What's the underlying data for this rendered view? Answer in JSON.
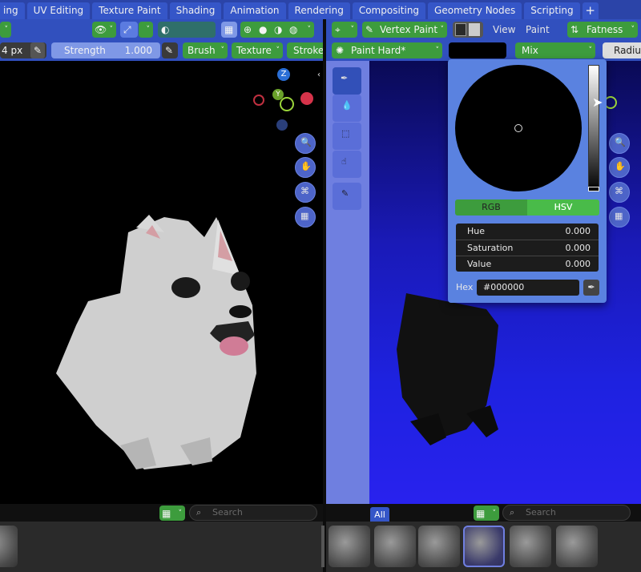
{
  "workspace_tabs": [
    "ing",
    "UV Editing",
    "Texture Paint",
    "Shading",
    "Animation",
    "Rendering",
    "Compositing",
    "Geometry Nodes",
    "Scripting"
  ],
  "add_tab_label": "+",
  "left_header": {
    "radius_value": "4 px",
    "strength_label": "Strength",
    "strength_value": "1.000",
    "brush_label": "Brush",
    "texture_label": "Texture",
    "stroke_label": "Stroke"
  },
  "right_header": {
    "mode_label": "Vertex Paint",
    "view_menu": "View",
    "paint_menu": "Paint",
    "fatness_label": "Fatness",
    "brush_name": "Paint Hard*",
    "blend_mode": "Mix",
    "radius_label": "Radiu"
  },
  "gizmo": {
    "z_label": "Z",
    "y_label": "Y"
  },
  "color_picker": {
    "rgb_tab": "RGB",
    "hsv_tab": "HSV",
    "fields": [
      {
        "label": "Hue",
        "value": "0.000"
      },
      {
        "label": "Saturation",
        "value": "0.000"
      },
      {
        "label": "Value",
        "value": "0.000"
      }
    ],
    "hex_label": "Hex",
    "hex_value": "#000000"
  },
  "search": {
    "left_placeholder": "Search",
    "right_placeholder": "Search"
  },
  "asset_filter_all": "All",
  "colors": {
    "accent": "#3556c8",
    "active_green": "#3d9c3d",
    "viewport_bg": "#000000"
  }
}
